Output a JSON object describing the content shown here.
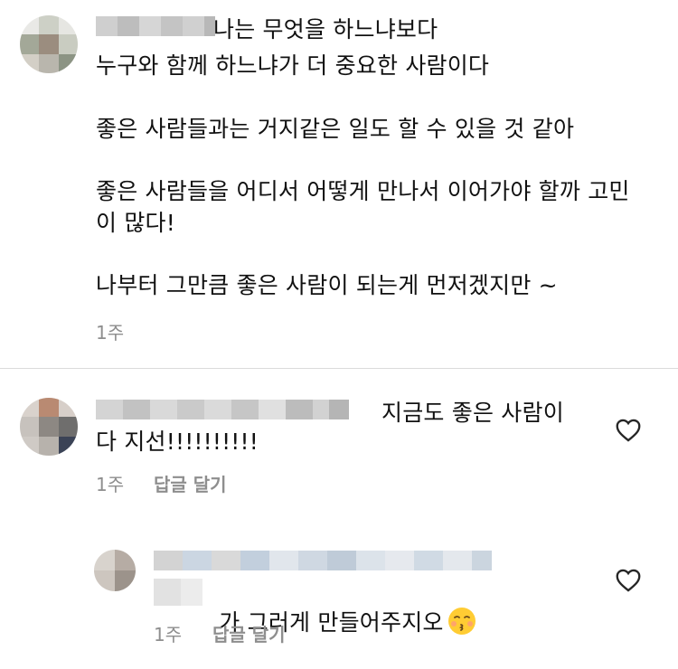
{
  "comments": [
    {
      "lines": [
        "나는 무엇을 하느냐보다",
        "누구와 함께 하느냐가 더 중요한 사람이다",
        "",
        "좋은 사람들과는 거지같은 일도 할 수 있을 것 같아",
        "",
        "좋은 사람들을 어디서 어떻게 만나서 이어가야 할까 고민",
        "이 많다!",
        "",
        "나부터 그만큼 좋은 사람이 되는게 먼저겠지만 ~"
      ],
      "time": "1주"
    },
    {
      "text_line1": "지금도 좋은 사람이",
      "text_line2": "다 지선!!!!!!!!!!",
      "time": "1주",
      "reply_label": "답글 달기"
    },
    {
      "text": "가 그러게 만들어주지오",
      "time": "1주",
      "reply_label": "답글 달기"
    }
  ],
  "icons": {
    "heart": "heart-icon",
    "emoji": "kissing-face-emoji"
  },
  "colors": {
    "meta": "#8e8e8e",
    "divider": "#dbdbdb",
    "text": "#111111"
  }
}
